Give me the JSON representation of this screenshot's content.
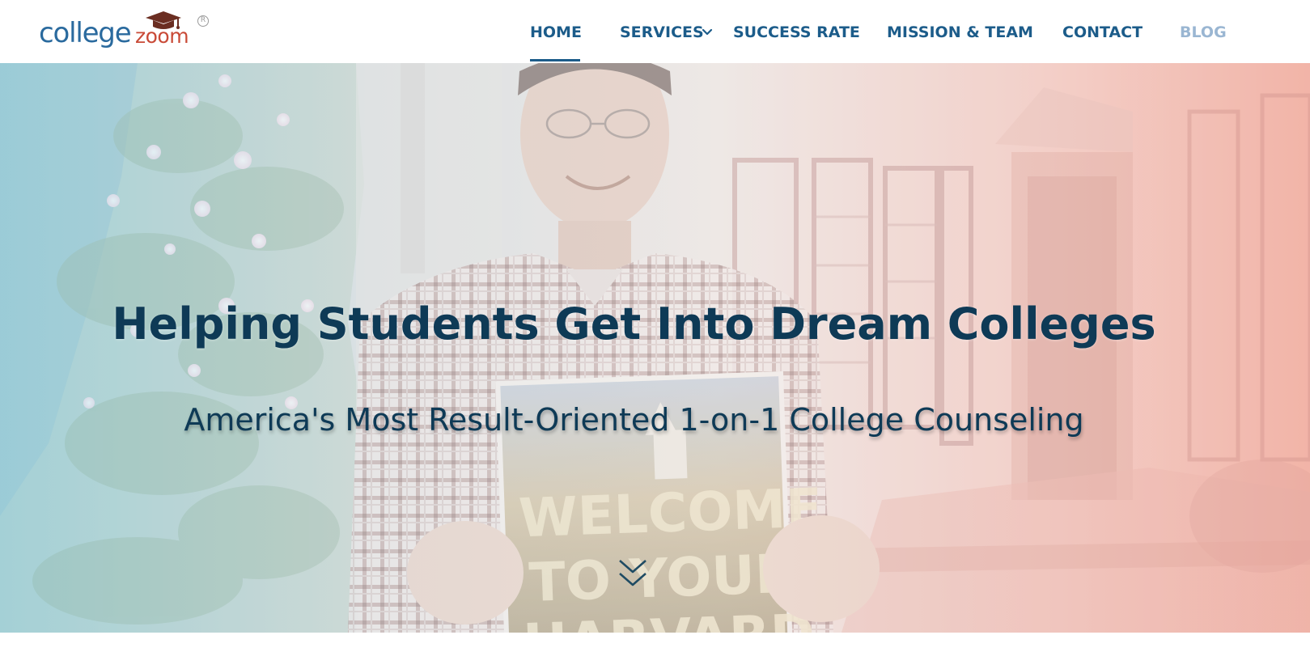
{
  "brand": {
    "logo_text_primary": "college",
    "logo_text_secondary": "zoom",
    "registered_mark": "R",
    "primary_color": "#2a6a9e",
    "accent_color": "#c94a37"
  },
  "nav": {
    "items": [
      {
        "label": "HOME",
        "active": true
      },
      {
        "label": "SERVICES",
        "has_dropdown": true
      },
      {
        "label": "SUCCESS RATE"
      },
      {
        "label": "MISSION & TEAM"
      },
      {
        "label": "CONTACT"
      },
      {
        "label": "BLOG",
        "muted": true
      }
    ],
    "text_color": "#1c5c8a",
    "muted_color": "#9ab6d2"
  },
  "hero": {
    "title": "Helping Students Get Into Dream Colleges",
    "subtitle": "America's Most Result-Oriented 1-on-1 College Counseling",
    "text_color": "#0e3a56",
    "photo_sign_text": "WELCOME TO YOUR HARVARD",
    "scroll_icon": "double-chevron-down-icon"
  }
}
